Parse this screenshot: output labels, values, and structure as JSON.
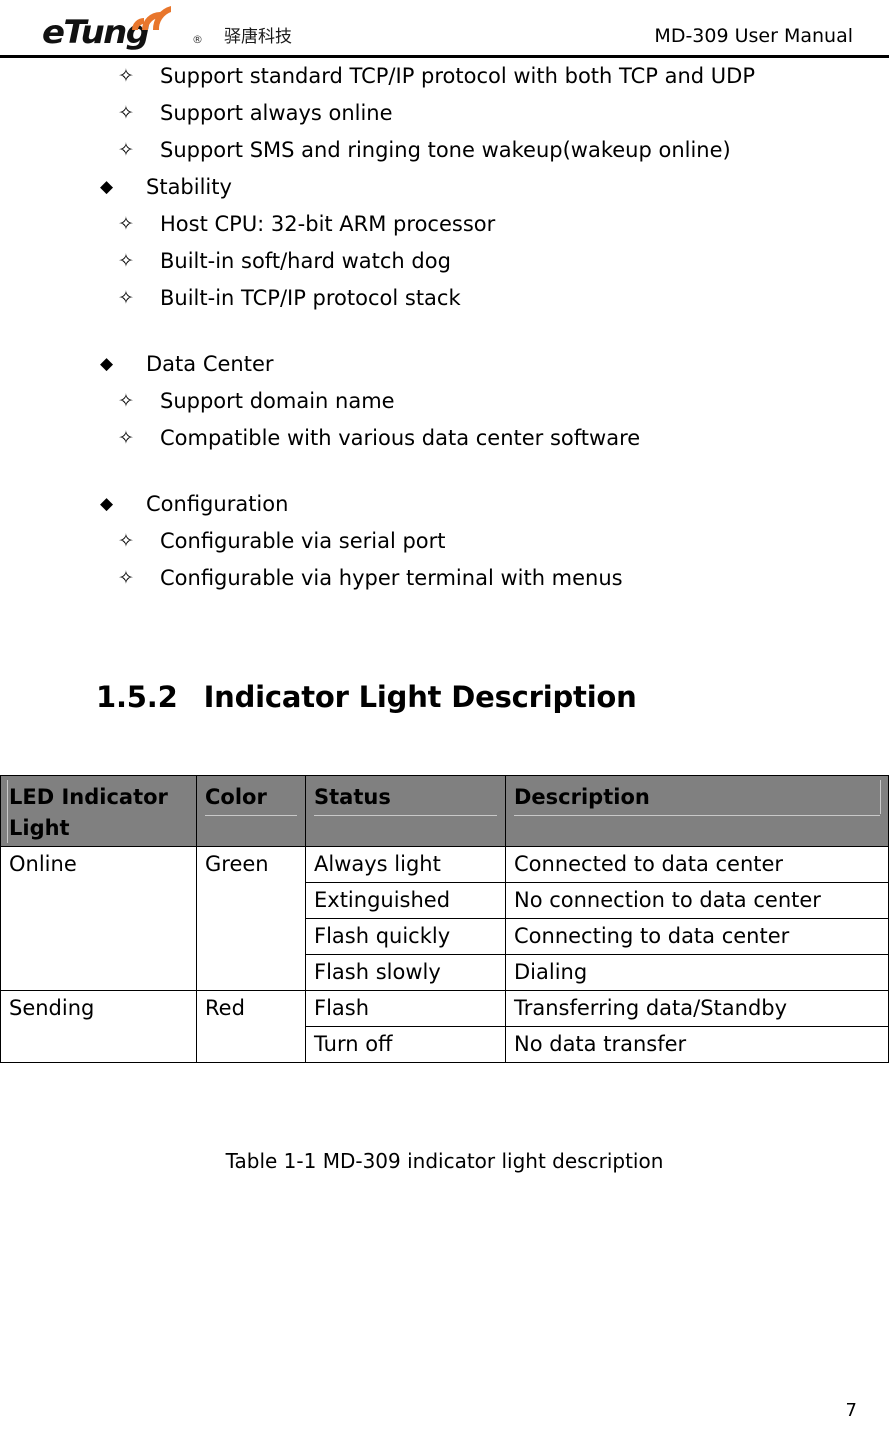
{
  "header": {
    "logo_word": "eTung",
    "logo_registered": "®",
    "logo_chinese": "驿唐科技",
    "manual_title": "MD-309 User Manual"
  },
  "bullets": {
    "filled": "◆",
    "hollow": "✧"
  },
  "top_list": [
    "Support standard TCP/IP protocol with both TCP and UDP",
    "Support always online",
    "Support SMS and ringing tone wakeup(wakeup online)"
  ],
  "groups": [
    {
      "title": "Stability",
      "items": [
        "Host CPU: 32-bit ARM processor",
        "Built-in soft/hard watch dog",
        "Built-in TCP/IP protocol stack"
      ]
    },
    {
      "title": "Data Center",
      "items": [
        "Support domain name",
        "Compatible with various data center software"
      ]
    },
    {
      "title": "Configuration",
      "items": [
        "Configurable via serial port",
        "Configurable via hyper terminal with menus"
      ]
    }
  ],
  "section": {
    "number": "1.5.2",
    "title": "Indicator Light Description"
  },
  "table": {
    "headers": [
      "LED Indicator Light",
      "Color",
      "Status",
      "Description"
    ],
    "header_bg": "#808080",
    "rows": [
      {
        "indicator": "Online",
        "color": "Green",
        "states": [
          {
            "status": "Always light",
            "description": "Connected to data center"
          },
          {
            "status": "Extinguished",
            "description": "No connection to data center"
          },
          {
            "status": "Flash quickly",
            "description": "Connecting to data center"
          },
          {
            "status": "Flash slowly",
            "description": "Dialing"
          }
        ]
      },
      {
        "indicator": "Sending",
        "color": "Red",
        "states": [
          {
            "status": "Flash",
            "description": "Transferring data/Standby"
          },
          {
            "status": "Turn off",
            "description": "No data transfer"
          }
        ]
      }
    ],
    "caption": "Table 1-1 MD-309 indicator light description"
  },
  "footer": {
    "page_number": "7"
  }
}
